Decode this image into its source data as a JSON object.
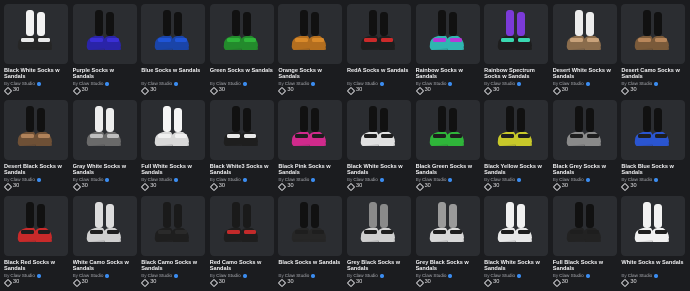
{
  "creator_prefix": "By",
  "items": [
    {
      "name": "Black White Socks w Sandals",
      "creator": "Claw Studio",
      "price": "30",
      "sock": "#f2f2f2",
      "strap": "#e9e9e9",
      "sole": "#262626"
    },
    {
      "name": "Purple Socks w Sandals",
      "creator": "Claw Studio",
      "price": "30",
      "sock": "#111111",
      "strap": "#3a2fd6",
      "sole": "#2a24a8"
    },
    {
      "name": "Blue Socks w Sandals",
      "creator": "Claw Studio",
      "price": "30",
      "sock": "#111111",
      "strap": "#1f55d8",
      "sole": "#1a44a8"
    },
    {
      "name": "Green Socks w Sandals",
      "creator": "Claw Studio",
      "price": "30",
      "sock": "#111111",
      "strap": "#2fb53a",
      "sole": "#238a2c"
    },
    {
      "name": "Orange Socks w Sandals",
      "creator": "Claw Studio",
      "price": "30",
      "sock": "#111111",
      "strap": "#d98a2a",
      "sole": "#b36e1f"
    },
    {
      "name": "RedA Socks w Sandals",
      "creator": "Claw Studio",
      "price": "30",
      "sock": "#111111",
      "strap": "#cc2a2a",
      "sole": "#1e1e1e"
    },
    {
      "name": "Rainbow Socks w Sandals",
      "creator": "Claw Studio",
      "price": "30",
      "sock": "#111111",
      "strap": "#b43ad8",
      "sole": "#2fb5b0"
    },
    {
      "name": "Rainbow Spectrum Socks w Sandals",
      "creator": "Claw Studio",
      "price": "30",
      "sock": "#7b3ad8",
      "strap": "#3ad8b0",
      "sole": "#1e1e1e"
    },
    {
      "name": "Desert White Socks w Sandals",
      "creator": "Claw Studio",
      "price": "30",
      "sock": "#ececec",
      "strap": "#c9a27a",
      "sole": "#8a6c4c"
    },
    {
      "name": "Desert Camo Socks w Sandals",
      "creator": "Claw Studio",
      "price": "30",
      "sock": "#111111",
      "strap": "#b8865a",
      "sole": "#7a5a3a"
    },
    {
      "name": "Desert Black Socks w Sandals",
      "creator": "Claw Studio",
      "price": "30",
      "sock": "#111111",
      "strap": "#b0825a",
      "sole": "#6e5036"
    },
    {
      "name": "Gray White Socks w Sandals",
      "creator": "Claw Studio",
      "price": "30",
      "sock": "#ededed",
      "strap": "#bfbfbf",
      "sole": "#6a6a6a"
    },
    {
      "name": "Full White Socks w Sandals",
      "creator": "Claw Studio",
      "price": "30",
      "sock": "#f5f5f5",
      "strap": "#f0f0f0",
      "sole": "#d8d8d8"
    },
    {
      "name": "Black White3 Socks w Sandals",
      "creator": "Claw Studio",
      "price": "30",
      "sock": "#111111",
      "strap": "#e8e8e8",
      "sole": "#1e1e1e"
    },
    {
      "name": "Black Pink Socks w Sandals",
      "creator": "Claw Studio",
      "price": "30",
      "sock": "#111111",
      "strap": "#1e1e1e",
      "sole": "#d02a8c"
    },
    {
      "name": "Black White Socks w Sandals",
      "creator": "Claw Studio",
      "price": "30",
      "sock": "#111111",
      "strap": "#1e1e1e",
      "sole": "#e0e0e0"
    },
    {
      "name": "Black Green Socks w Sandals",
      "creator": "Claw Studio",
      "price": "30",
      "sock": "#111111",
      "strap": "#1e1e1e",
      "sole": "#2fb53a"
    },
    {
      "name": "Black Yellow Socks w Sandals",
      "creator": "Claw Studio",
      "price": "30",
      "sock": "#111111",
      "strap": "#1e1e1e",
      "sole": "#c8c82a"
    },
    {
      "name": "Black Grey Socks w Sandals",
      "creator": "Claw Studio",
      "price": "30",
      "sock": "#111111",
      "strap": "#1e1e1e",
      "sole": "#8a8a8a"
    },
    {
      "name": "Black Blue Socks w Sandals",
      "creator": "Claw Studio",
      "price": "30",
      "sock": "#111111",
      "strap": "#1e1e1e",
      "sole": "#2a55d0"
    },
    {
      "name": "Black Red Socks w Sandals",
      "creator": "Claw Studio",
      "price": "30",
      "sock": "#111111",
      "strap": "#1e1e1e",
      "sole": "#c82a2a"
    },
    {
      "name": "White Camo Socks w Sandals",
      "creator": "Claw Studio",
      "price": "30",
      "sock": "#dcdcdc",
      "strap": "#1e1e1e",
      "sole": "#cfcfcf"
    },
    {
      "name": "Black Camo Socks w Sandals",
      "creator": "Claw Studio",
      "price": "30",
      "sock": "#1a1a1a",
      "strap": "#2a2a2a",
      "sole": "#1e1e1e"
    },
    {
      "name": "Red Camo Socks w Sandals",
      "creator": "Claw Studio",
      "price": "30",
      "sock": "#1a1a1a",
      "strap": "#c22a2a",
      "sole": "#1e1e1e"
    },
    {
      "name": "Black Socks w Sandals",
      "creator": "Claw Studio",
      "price": "30",
      "sock": "#111111",
      "strap": "#1e1e1e",
      "sole": "#262626"
    },
    {
      "name": "Grey Black Socks w Sandals",
      "creator": "Claw Studio",
      "price": "30",
      "sock": "#8a8a8a",
      "strap": "#1e1e1e",
      "sole": "#cfcfcf"
    },
    {
      "name": "Grey Black Socks w Sandals",
      "creator": "Claw Studio",
      "price": "30",
      "sock": "#9a9a9a",
      "strap": "#1e1e1e",
      "sole": "#d8d8d8"
    },
    {
      "name": "Black White Socks w Sandals",
      "creator": "Claw Studio",
      "price": "30",
      "sock": "#f0f0f0",
      "strap": "#1e1e1e",
      "sole": "#e8e8e8"
    },
    {
      "name": "Full Black Socks w Sandals",
      "creator": "Claw Studio",
      "price": "30",
      "sock": "#111111",
      "strap": "#1e1e1e",
      "sole": "#222222"
    },
    {
      "name": "White Socks w Sandals",
      "creator": "Claw Studio",
      "price": "30",
      "sock": "#f2f2f2",
      "strap": "#1e1e1e",
      "sole": "#f0f0f0"
    }
  ]
}
